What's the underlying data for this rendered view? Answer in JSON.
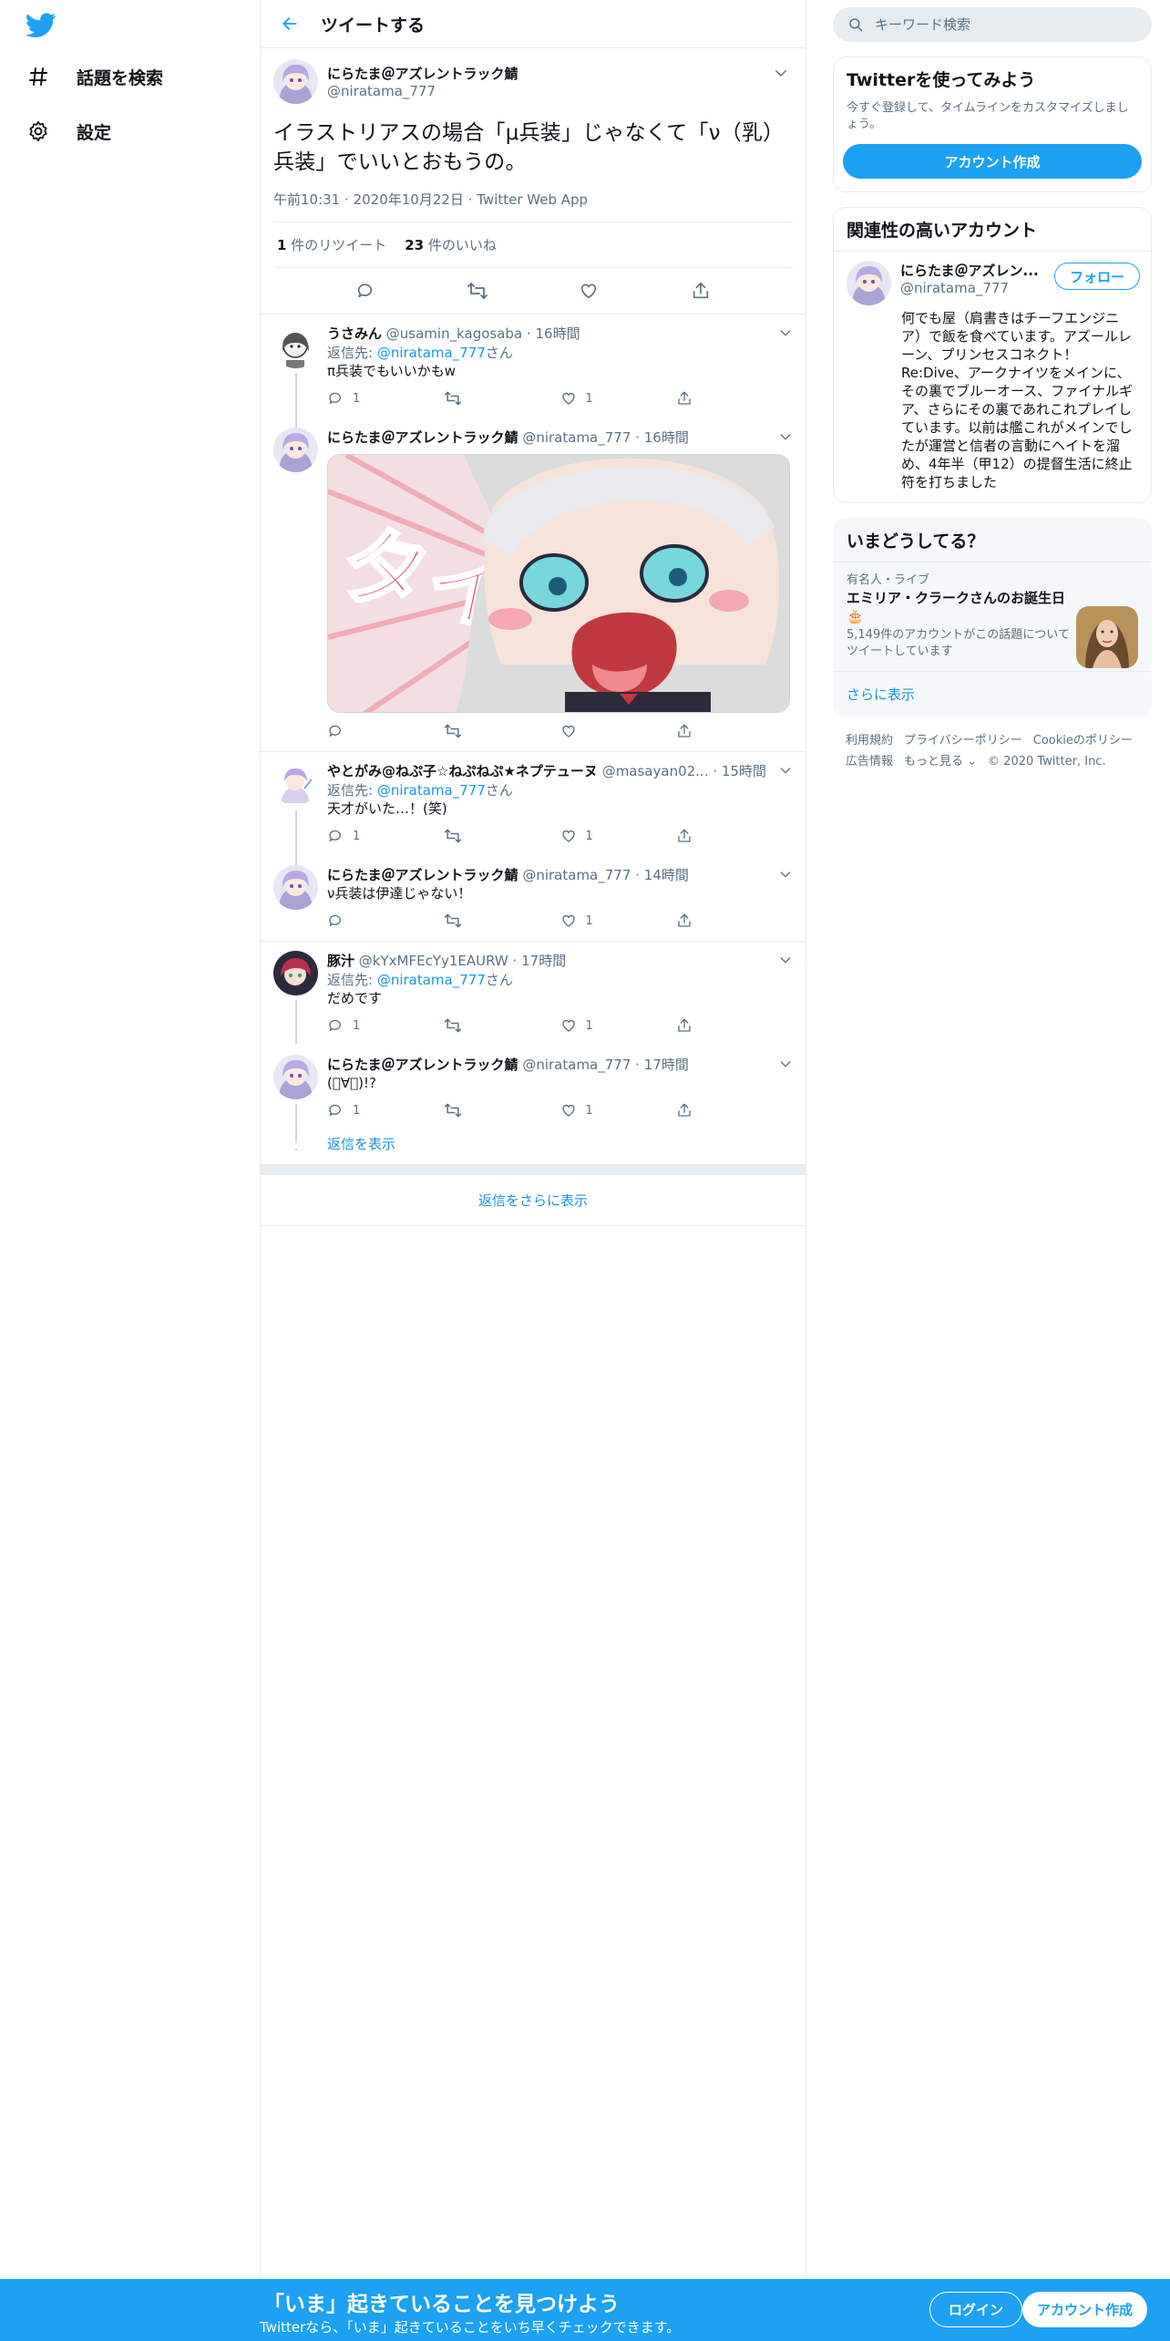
{
  "colors": {
    "accent": "#1da1f2",
    "link": "#1b95e0",
    "muted": "#5b7083",
    "border": "#e6ecf0"
  },
  "nav": {
    "logo_icon": "twitter-bird-icon",
    "items": [
      {
        "label": "話題を検索",
        "icon": "hashtag-icon"
      },
      {
        "label": "設定",
        "icon": "gear-icon"
      }
    ]
  },
  "header": {
    "title": "ツイートする",
    "back_icon": "arrow-left-icon"
  },
  "focal": {
    "name": "にらたま＠アズレントラック鯖",
    "handle": "@niratama_777",
    "text": "イラストリアスの場合「μ兵装」じゃなくて「ν（乳）兵装」でいいとおもうの。",
    "time": "午前10:31",
    "date": "2020年10月22日",
    "source": "Twitter Web App",
    "retweets_num": "1",
    "retweets_label": "件のリツイート",
    "likes_num": "23",
    "likes_label": "件のいいね"
  },
  "replies": [
    {
      "name": "うさみん",
      "handle": "@usamin_kagosaba",
      "time": "16時間",
      "replyto_prefix": "返信先: ",
      "replyto_handle": "@niratama_777",
      "replyto_suffix": "さん",
      "text": "π兵装でもいいかもw",
      "reply_count": "1",
      "retweet_count": "",
      "like_count": "1"
    },
    {
      "name": "にらたま＠アズレントラック鯖",
      "handle": "@niratama_777",
      "time": "16時間",
      "text": "",
      "reply_count": "",
      "retweet_count": "",
      "like_count": ""
    },
    {
      "name": "やとがみ@ねぷ子☆ねぷねぷ★ネプテューヌ",
      "handle": "@masayan02...",
      "time": "15時間",
      "replyto_prefix": "返信先: ",
      "replyto_handle": "@niratama_777",
      "replyto_suffix": "さん",
      "text": "天才がいた…！(笑)",
      "reply_count": "1",
      "retweet_count": "",
      "like_count": "1"
    },
    {
      "name": "にらたま＠アズレントラック鯖",
      "handle": "@niratama_777",
      "time": "14時間",
      "text": "ν兵装は伊達じゃない！",
      "reply_count": "",
      "retweet_count": "",
      "like_count": "1"
    },
    {
      "name": "豚汁",
      "handle": "@kYxMFEcYy1EAURW",
      "time": "17時間",
      "replyto_prefix": "返信先: ",
      "replyto_handle": "@niratama_777",
      "replyto_suffix": "さん",
      "text": "だめです",
      "reply_count": "1",
      "retweet_count": "",
      "like_count": "1"
    },
    {
      "name": "にらたま＠アズレントラック鯖",
      "handle": "@niratama_777",
      "time": "17時間",
      "text": "(ﾟ∀ﾟ)!?",
      "reply_count": "1",
      "retweet_count": "",
      "like_count": "1"
    }
  ],
  "show_replies_label": "返信を表示",
  "more_replies_label": "返信をさらに表示",
  "right": {
    "search_placeholder": "キーワード検索",
    "signup": {
      "title": "Twitterを使ってみよう",
      "sub": "今すぐ登録して、タイムラインをカスタマイズしましょう。",
      "button": "アカウント作成"
    },
    "related": {
      "title": "関連性の高いアカウント",
      "name": "にらたま＠アズレン...",
      "handle": "@niratama_777",
      "follow": "フォロー",
      "bio": "何でも屋（肩書きはチーフエンジニア）で飯を食べています。アズールレーン、プリンセスコネクト！Re:Dive、アークナイツをメインに、その裏でブルーオース、ファイナルギア、さらにその裏であれこれプレイしています。以前は艦これがメインでしたが運営と信者の言動にヘイトを溜め、4年半（甲12）の提督生活に終止符を打ちました"
    },
    "trends": {
      "title": "いまどうしてる？",
      "category": "有名人・ライブ",
      "headline": "エミリア・クラークさんのお誕生日🎂",
      "count": "5,149件のアカウントがこの話題についてツイートしています",
      "show_more": "さらに表示"
    },
    "footer": [
      "利用規約",
      "プライバシーポリシー",
      "Cookieのポリシー",
      "広告情報",
      "もっと見る ⌄",
      "© 2020 Twitter, Inc."
    ]
  },
  "bottom_bar": {
    "title": "「いま」起きていることを見つけよう",
    "sub": "Twitterなら、「いま」起きていることをいち早くチェックできます。",
    "login": "ログイン",
    "signup": "アカウント作成"
  }
}
